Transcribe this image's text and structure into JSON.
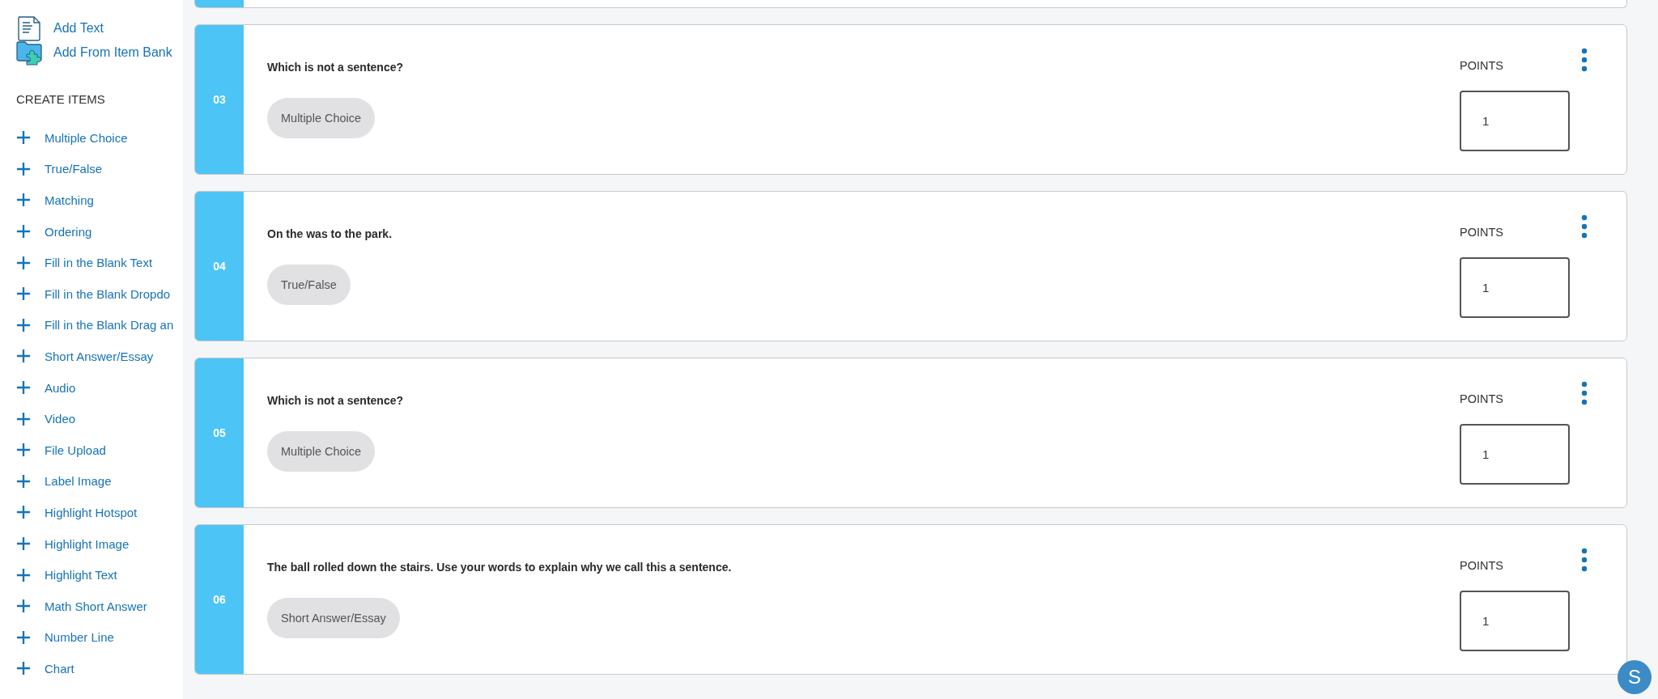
{
  "sidebar": {
    "actions": [
      {
        "label": "Add Text",
        "kind": "text"
      },
      {
        "label": "Add From Item Bank",
        "kind": "bank"
      }
    ],
    "section_title": "CREATE ITEMS",
    "items": [
      "Multiple Choice",
      "True/False",
      "Matching",
      "Ordering",
      "Fill in the Blank Text",
      "Fill in the Blank Dropdo",
      "Fill in the Blank Drag an",
      "Short Answer/Essay",
      "Audio",
      "Video",
      "File Upload",
      "Label Image",
      "Highlight Hotspot",
      "Highlight Image",
      "Highlight Text",
      "Math Short Answer",
      "Number Line",
      "Chart"
    ]
  },
  "questions": [
    {
      "number": "03",
      "text": "Which is not a sentence?",
      "type": "Multiple Choice",
      "points_label": "POINTS",
      "points": "1"
    },
    {
      "number": "04",
      "text": "On the was to the park.",
      "type": "True/False",
      "points_label": "POINTS",
      "points": "1"
    },
    {
      "number": "05",
      "text": "Which is not a sentence?",
      "type": "Multiple Choice",
      "points_label": "POINTS",
      "points": "1"
    },
    {
      "number": "06",
      "text": "The ball rolled down the stairs.  Use your words to explain why we call this a sentence.",
      "type": "Short Answer/Essay",
      "points_label": "POINTS",
      "points": "1"
    }
  ],
  "user_avatar": {
    "initial": "S"
  }
}
